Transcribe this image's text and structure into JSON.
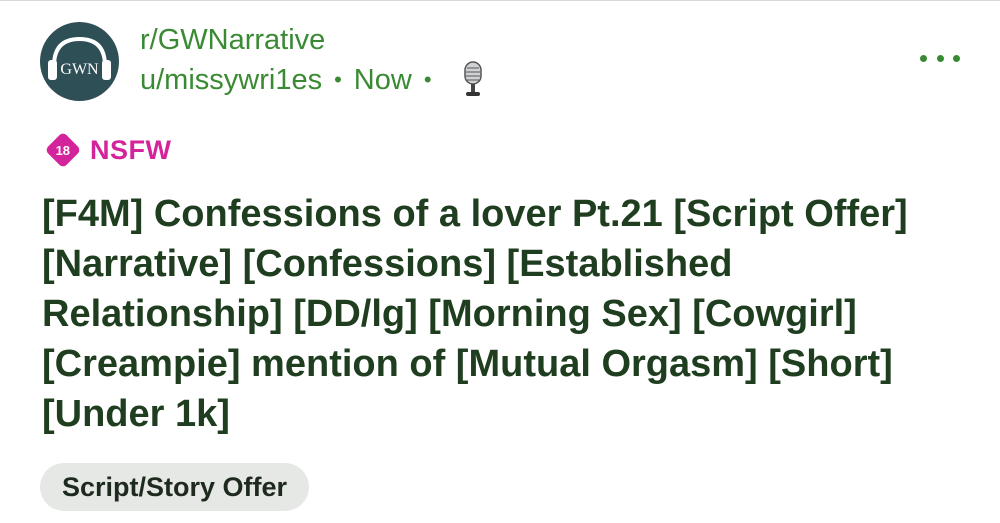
{
  "header": {
    "avatar_text": "GWN",
    "subreddit": "r/GWNarrative",
    "username": "u/missywri1es",
    "separator": "•",
    "time": "Now",
    "mic_icon": "microphone-icon",
    "more_icon": "more-options-icon"
  },
  "nsfw": {
    "badge": "18",
    "label": "NSFW",
    "color": "#d4249b"
  },
  "post": {
    "title": "[F4M] Confessions of a lover Pt.21 [Script Offer] [Narrative] [Confessions] [Established Relationship] [DD/lg] [Morning Sex] [Cowgirl] [Creampie] mention of [Mutual Orgasm] [Short] [Under 1k]",
    "flair": "Script/Story Offer"
  },
  "colors": {
    "accent_green": "#3a8a34",
    "title_text": "#1f3d1f",
    "flair_bg": "#e6e8e6",
    "avatar_bg": "#2f4f57"
  }
}
